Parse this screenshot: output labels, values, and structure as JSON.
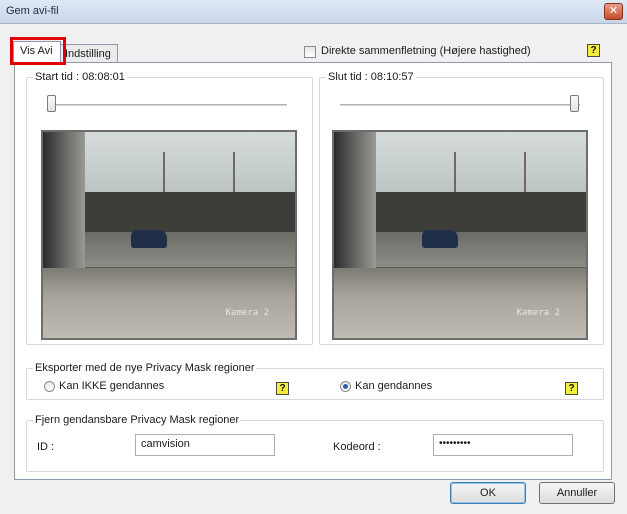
{
  "window": {
    "title": "Gem avi-fil",
    "close_symbol": "✕"
  },
  "tabs": [
    {
      "label": "Vis Avi",
      "active": true
    },
    {
      "label": "Indstilling",
      "active": false
    }
  ],
  "direct_merge": {
    "label": "Direkte sammenfletning (Højere hastighed)",
    "checked": false
  },
  "help_glyph": "?",
  "start": {
    "label": "Start tid : 08:08:01",
    "slider_value": 0.0,
    "video_overlay": "Kamera 2"
  },
  "end": {
    "label": "Slut tid : 08:10:57",
    "slider_value": 1.0,
    "video_overlay": "Kamera 2"
  },
  "export_privacy": {
    "title": "Eksporter med de nye Privacy Mask regioner",
    "option_no_restore": "Kan IKKE gendannes",
    "option_restore": "Kan gendannes",
    "selected": "Kan gendannes"
  },
  "remove_privacy": {
    "title": "Fjern gendansbare Privacy Mask regioner",
    "id_label": "ID :",
    "id_value": "camvision",
    "password_label": "Kodeord :",
    "password_value": "•••••••••"
  },
  "buttons": {
    "ok": "OK",
    "cancel": "Annuller"
  },
  "colors": {
    "highlight": "#e00000",
    "help_bg": "#f6ee3c",
    "titlebar": "#c9d6ea"
  }
}
